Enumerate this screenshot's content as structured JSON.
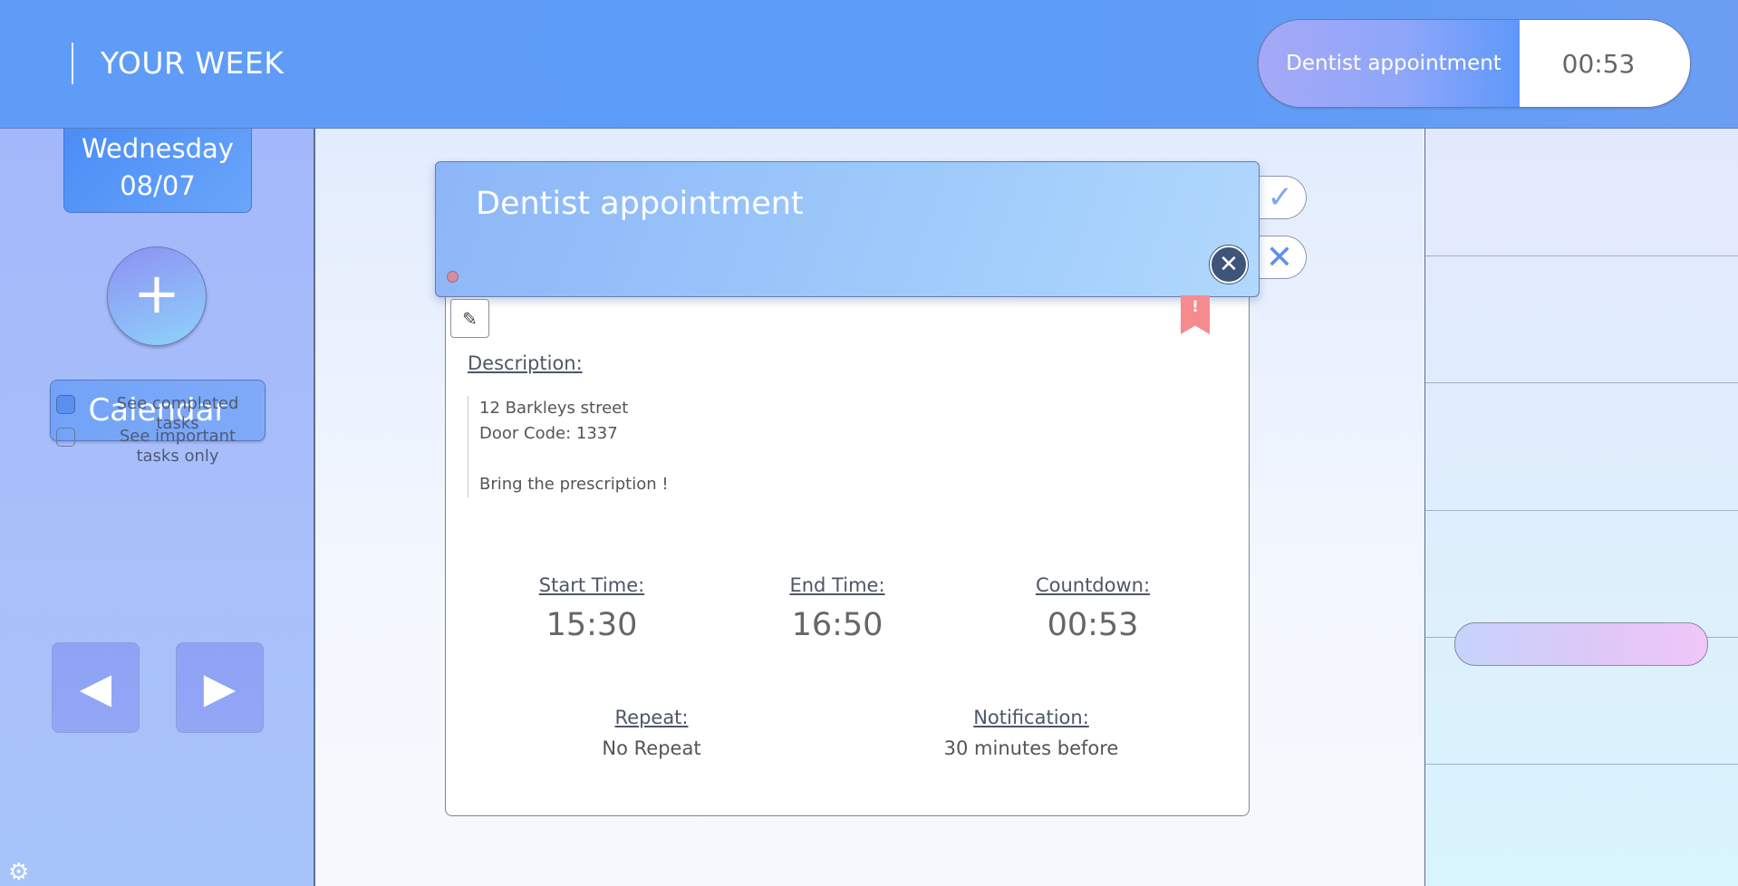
{
  "header": {
    "title": "YOUR WEEK",
    "current_task": {
      "name": "Dentist appointment",
      "countdown": "00:53"
    }
  },
  "sidebar": {
    "day": "Wednesday",
    "date": "08/07",
    "add_symbol": "+",
    "calendar_label": "Calendar",
    "filters": [
      {
        "label": "See completed tasks",
        "checked": true
      },
      {
        "label": "See important tasks only",
        "checked": false
      }
    ],
    "prev_symbol": "◀",
    "next_symbol": "▶"
  },
  "task": {
    "title": "Dentist appointment",
    "important_symbol": "!",
    "description_label": "Description:",
    "description": "12 Barkleys street\nDoor Code: 1337\n\nBring the prescription !",
    "start_label": "Start Time:",
    "start_value": "15:30",
    "end_label": "End Time:",
    "end_value": "16:50",
    "countdown_label": "Countdown:",
    "countdown_value": "00:53",
    "repeat_label": "Repeat:",
    "repeat_value": "No Repeat",
    "notification_label": "Notification:",
    "notification_value": "30 minutes before",
    "complete_symbol": "✓",
    "delete_symbol": "✕",
    "close_symbol": "✕",
    "edit_symbol": "✎"
  },
  "colors": {
    "header": "#5f9cf7",
    "accent": "#5a8ff0",
    "important_flag": "#f58b8f"
  },
  "icons": {
    "gear": "gear-icon",
    "edit": "pencil-icon",
    "close": "close-icon",
    "flag": "important-flag-icon"
  }
}
